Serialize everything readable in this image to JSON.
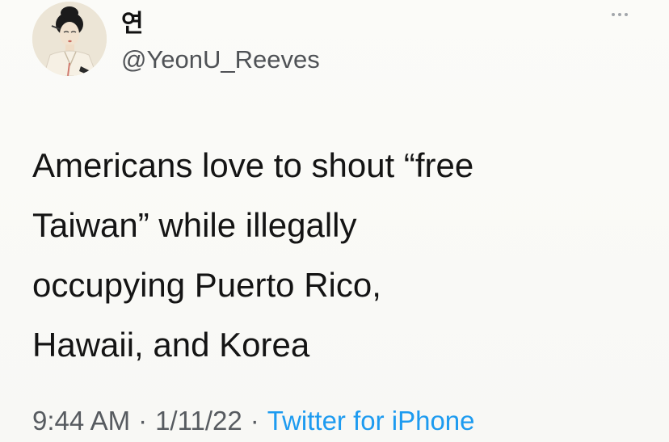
{
  "tweet": {
    "author": {
      "display_name": "연",
      "handle": "@YeonU_Reeves",
      "avatar_icon": "avatar-portrait"
    },
    "more_icon": "more-options-icon",
    "text": "Americans love to shout “free\nTaiwan” while illegally\noccupying Puerto Rico,\nHawaii, and Korea",
    "meta": {
      "time": "9:44 AM",
      "date": "1/11/22",
      "separator": "·",
      "source": "Twitter for iPhone"
    }
  },
  "colors": {
    "background": "#fbfbf8",
    "text": "#141414",
    "secondary_text": "#575b60",
    "link": "#1d9bf0"
  }
}
